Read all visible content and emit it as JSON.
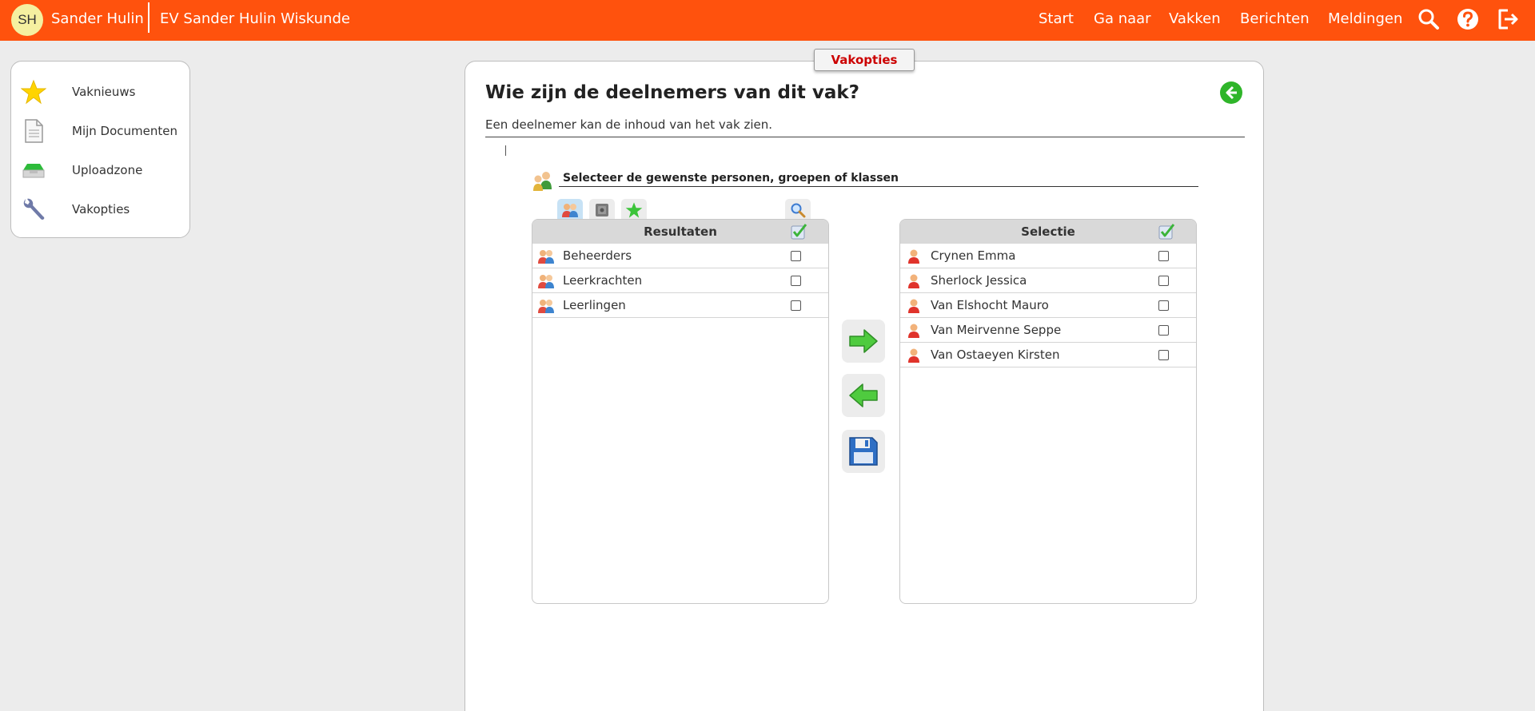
{
  "topbar": {
    "avatar_initials": "SH",
    "username": "Sander Hulin",
    "course_title": "EV Sander Hulin Wiskunde",
    "nav": [
      "Start",
      "Ga naar",
      "Vakken",
      "Berichten",
      "Meldingen"
    ],
    "icons": [
      "search-icon",
      "help-icon",
      "logout-icon"
    ],
    "color": "#ff520d"
  },
  "sidebar": {
    "items": [
      {
        "label": "Vaknieuws",
        "icon": "star-icon"
      },
      {
        "label": "Mijn Documenten",
        "icon": "document-icon"
      },
      {
        "label": "Uploadzone",
        "icon": "tray-icon"
      },
      {
        "label": "Vakopties",
        "icon": "wrench-icon"
      }
    ]
  },
  "main": {
    "tab_label": "Vakopties",
    "title": "Wie zijn de deelnemers van dit vak?",
    "subtitle": "Een deelnemer kan de inhoud van het vak zien.",
    "selector_heading": "Selecteer de gewenste personen, groepen of klassen",
    "results": {
      "title": "Resultaten",
      "rows": [
        "Beheerders",
        "Leerkrachten",
        "Leerlingen"
      ]
    },
    "selection": {
      "title": "Selectie",
      "rows": [
        "Crynen Emma",
        "Sherlock Jessica",
        "Van Elshocht Mauro",
        "Van Meirvenne Seppe",
        "Van Ostaeyen Kirsten"
      ]
    }
  }
}
